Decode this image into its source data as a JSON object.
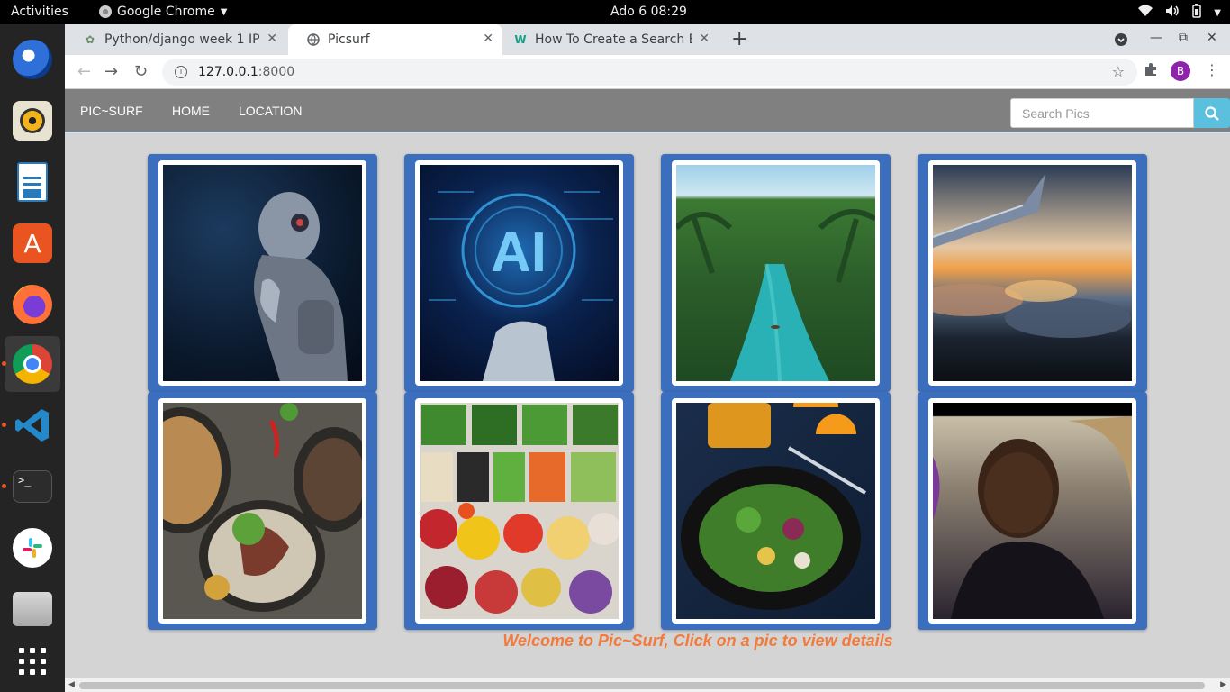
{
  "system": {
    "activities": "Activities",
    "app_name": "Google Chrome",
    "clock": "Ado 6  08:29"
  },
  "browser": {
    "tabs": [
      {
        "title": "Python/django week 1 IP",
        "favicon": "plant-icon"
      },
      {
        "title": "Picsurf",
        "favicon": "globe-icon"
      },
      {
        "title": "How To Create a Search B",
        "favicon": "w-logo-icon"
      }
    ],
    "url_host": "127.0.0.1",
    "url_port": ":8000",
    "profile_initial": "B"
  },
  "site": {
    "nav": {
      "brand": "PIC~SURF",
      "home": "HOME",
      "location": "LOCATION"
    },
    "search": {
      "placeholder": "Search Pics"
    },
    "cards": [
      {
        "subject": "humanoid robot",
        "colors": [
          "#0b1a2e",
          "#8a95a5"
        ]
      },
      {
        "subject": "AI hologram hand",
        "colors": [
          "#071636",
          "#3fb8ff"
        ]
      },
      {
        "subject": "tropical river palms",
        "colors": [
          "#2b5d2a",
          "#29b1b5"
        ]
      },
      {
        "subject": "airplane wing sunset clouds",
        "colors": [
          "#f0a04a",
          "#1b2430"
        ]
      },
      {
        "subject": "grilled meat salad plates",
        "colors": [
          "#5a5650",
          "#9a7a5a"
        ]
      },
      {
        "subject": "vegetable salad bar",
        "colors": [
          "#d9d4cc",
          "#3f8a2e"
        ]
      },
      {
        "subject": "salad with orange juice",
        "colors": [
          "#0f1d33",
          "#f4a21a"
        ]
      },
      {
        "subject": "portrait selfie",
        "colors": [
          "#2a2430",
          "#c9bfa8"
        ]
      }
    ],
    "welcome": "Welcome to Pic~Surf, Click on a pic to view details"
  }
}
